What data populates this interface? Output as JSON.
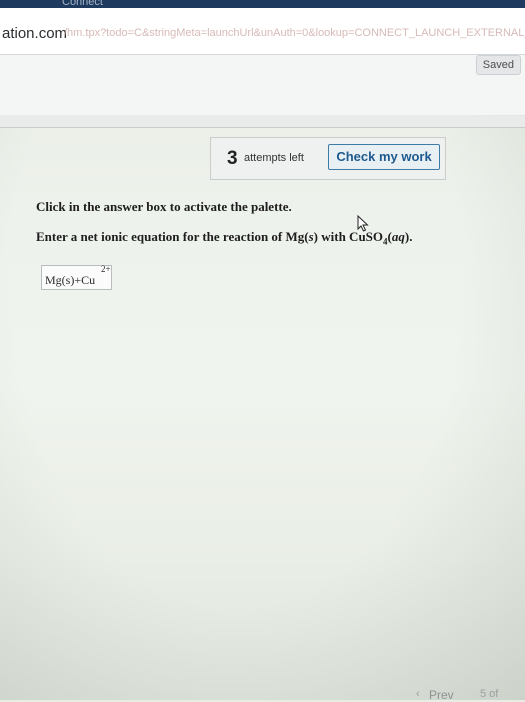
{
  "browser": {
    "tab_fragment": "Connect",
    "url_domain": "ation.com",
    "url_path": "/hm.tpx?todo=C&stringMeta=launchUrl&unAuth=0&lookup=CONNECT_LAUNCH_EXTERNAL_NOHASH_TRUE_LOGIN&class=external_browser"
  },
  "header": {
    "saved_label": "Saved"
  },
  "attempts": {
    "count": "3",
    "label": "attempts left",
    "check_button": "Check my work"
  },
  "question": {
    "instruction": "Click in the answer box to activate the palette.",
    "prompt_prefix": "Enter a net ionic equation for the reaction of Mg(",
    "prompt_s": "s",
    "prompt_mid": ") with CuSO",
    "prompt_sub": "4",
    "prompt_paren_open": "(",
    "prompt_aq": "aq",
    "prompt_end": ")."
  },
  "answer": {
    "value": "Mg(s)+Cu",
    "charge": "2+"
  },
  "footer": {
    "prev_label": "Prev",
    "page_fragment": "5 of"
  },
  "colors": {
    "accent": "#1f5a8e",
    "button_border": "#3e7ba7"
  }
}
